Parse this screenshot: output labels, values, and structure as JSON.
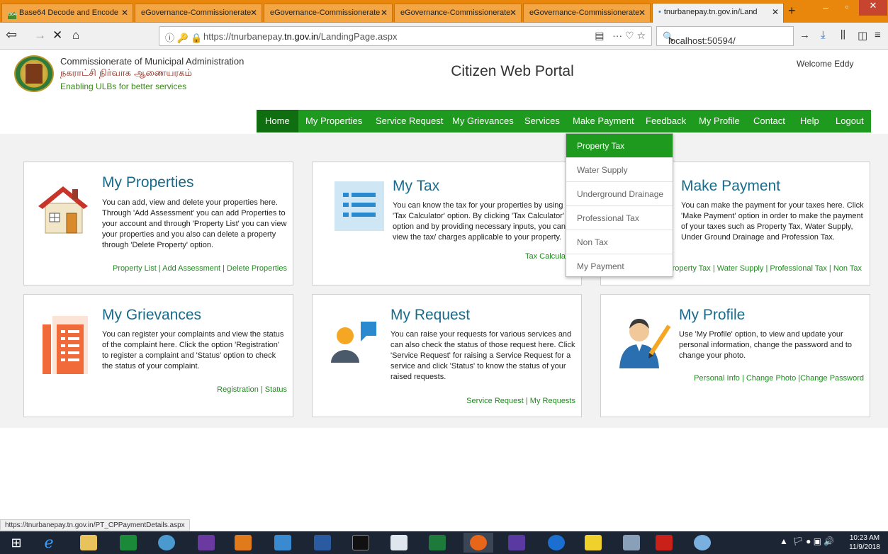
{
  "browser": {
    "tabs": [
      {
        "label": "Base64 Decode and Encode",
        "fav": "B64"
      },
      {
        "label": "eGovernance-Commissionerate",
        "fav": ""
      },
      {
        "label": "eGovernance-Commissionerate",
        "fav": ""
      },
      {
        "label": "eGovernance-Commissionerate",
        "fav": ""
      },
      {
        "label": "eGovernance-Commissionerate",
        "fav": ""
      },
      {
        "label": "tnurbanepay.tn.gov.in/Land",
        "fav": "•"
      }
    ],
    "url_host": "https://tnurbanepay.",
    "url_bold": "tn.gov.in",
    "url_path": "/LandingPage.aspx",
    "search_value": "localhost:50594/",
    "status_url": "https://tnurbanepay.tn.gov.in/PT_CPPaymentDetails.aspx"
  },
  "header": {
    "org_en": "Commissionerate of Municipal Administration",
    "org_ta": "நகராட்சி நிர்வாக ஆணையரகம்",
    "tagline": "Enabling ULBs for better services",
    "portal_title": "Citizen Web Portal",
    "welcome": "Welcome Eddy"
  },
  "menu": [
    "Home",
    "My Properties",
    "Service Request",
    "My Grievances",
    "Services",
    "Make Payment",
    "Feedback",
    "My Profile",
    "Contact",
    "Help",
    "Logout"
  ],
  "dropdown": [
    "Property Tax",
    "Water Supply",
    "Underground Drainage",
    "Professional Tax",
    "Non Tax",
    "My Payment"
  ],
  "cards": {
    "properties": {
      "title": "My Properties",
      "text": "You can add, view and delete your properties here. Through 'Add Assessment' you can add Properties to your account and through 'Property List' you can view your properties and you also can delete a property through 'Delete Property' option.",
      "links": "Property List | Add Assessment | Delete Properties"
    },
    "tax": {
      "title": "My Tax",
      "text": "You can know the tax for your properties by using 'Tax Calculator' option. By clicking 'Tax Calculator' option and by providing necessary inputs, you can view the tax/ charges applicable to your property.",
      "links": "Tax Calculator"
    },
    "payment": {
      "title": "Make Payment",
      "text": "You can make the payment for your taxes here. Click 'Make Payment' option in order to make the payment of your taxes such as Property Tax, Water Supply, Under Ground Drainage and Profession Tax.",
      "links": "Property Tax | Water Supply | Professional Tax | Non Tax"
    },
    "grievances": {
      "title": "My Grievances",
      "text": "You can register your complaints and view the status of the complaint here. Click the option 'Registration' to register a complaint and 'Status' option to check the status of your complaint.",
      "links": "Registration | Status"
    },
    "request": {
      "title": "My Request",
      "text": "You can raise your requests for various services and can also check the status of those request here. Click 'Service Request' for raising a Service Request for a service and click 'Status' to know the status of your raised requests.",
      "links": "Service Request | My Requests"
    },
    "profile": {
      "title": "My Profile",
      "text": "Use 'My Profile' option, to view and update your personal information, change the password and to change your photo.",
      "links": "Personal Info | Change Photo |Change Password"
    }
  },
  "clock": {
    "time": "10:23 AM",
    "date": "11/9/2018"
  },
  "colors": {
    "menu_green": "#1e9a1e",
    "home_green": "#0f6e0f",
    "title_blue": "#1a6b8a",
    "link_green": "#1f8a1f",
    "tab_orange": "#e8870c"
  }
}
